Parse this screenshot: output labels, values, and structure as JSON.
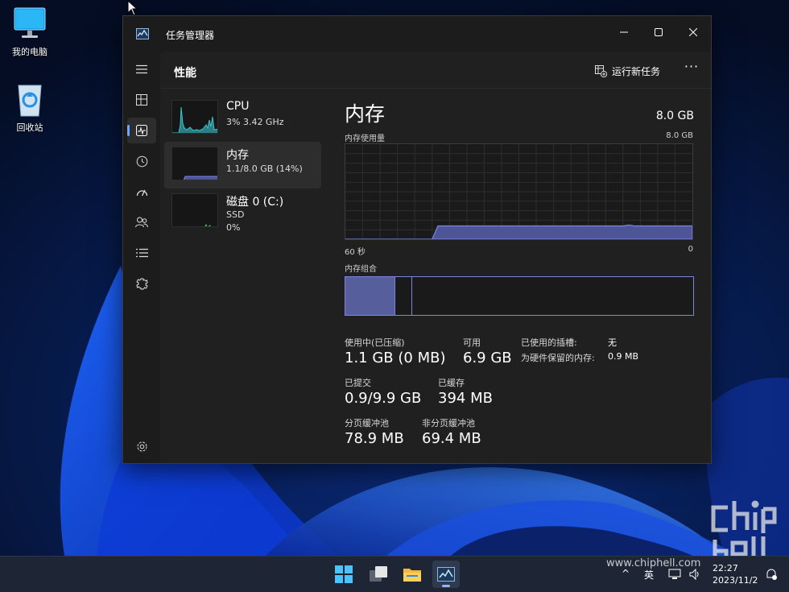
{
  "desktop": {
    "icons": [
      {
        "label": "我的电脑",
        "icon": "monitor-icon"
      },
      {
        "label": "回收站",
        "icon": "recycle-bin-icon"
      }
    ]
  },
  "window": {
    "title": "任务管理器",
    "app_icon": "task-manager-icon"
  },
  "nav": {
    "items": [
      {
        "icon": "hamburger-menu-icon"
      },
      {
        "icon": "processes-icon"
      },
      {
        "icon": "performance-icon",
        "active": true
      },
      {
        "icon": "app-history-icon"
      },
      {
        "icon": "startup-apps-icon"
      },
      {
        "icon": "users-icon"
      },
      {
        "icon": "details-icon"
      },
      {
        "icon": "services-icon"
      },
      {
        "icon": "settings-icon"
      }
    ]
  },
  "header": {
    "title": "性能",
    "run_task_label": "运行新任务",
    "more_label": "···"
  },
  "devices": [
    {
      "name": "CPU",
      "sub1": "3% 3.42 GHz",
      "sub2": ""
    },
    {
      "name": "内存",
      "sub1": "1.1/8.0 GB (14%)",
      "sub2": "",
      "selected": true
    },
    {
      "name": "磁盘 0 (C:)",
      "sub1": "SSD",
      "sub2": "0%"
    }
  ],
  "memory": {
    "title": "内存",
    "total": "8.0 GB",
    "usage_label": "内存使用量",
    "usage_max": "8.0 GB",
    "time_left": "60 秒",
    "time_right": "0",
    "composition_label": "内存组合",
    "usage_history_percent": [
      0,
      0,
      0,
      0,
      0,
      0,
      0,
      0,
      0,
      0,
      0,
      0,
      0,
      0,
      0,
      0,
      14,
      14,
      14,
      14,
      14,
      14,
      14,
      14,
      14,
      14,
      14,
      14,
      14,
      14,
      14,
      14,
      14,
      14,
      14,
      14,
      14,
      14,
      14,
      14,
      14,
      14,
      14,
      14,
      14,
      14,
      14,
      14,
      14,
      15,
      14,
      14,
      14,
      14,
      14,
      14,
      14,
      14,
      14,
      14,
      14
    ],
    "composition": {
      "in_use_fraction": 0.14,
      "modified_fraction": 0.05
    },
    "stats": {
      "in_use": {
        "label": "使用中(已压缩)",
        "value": "1.1 GB (0 MB)"
      },
      "available": {
        "label": "可用",
        "value": "6.9 GB"
      },
      "slots_used": {
        "label": "已使用的插槽:",
        "value": "无"
      },
      "hw_reserved": {
        "label": "为硬件保留的内存:",
        "value": "0.9 MB"
      },
      "committed": {
        "label": "已提交",
        "value": "0.9/9.9 GB"
      },
      "cached": {
        "label": "已缓存",
        "value": "394 MB"
      },
      "paged_pool": {
        "label": "分页缓冲池",
        "value": "78.9 MB"
      },
      "nonpaged_pool": {
        "label": "非分页缓冲池",
        "value": "69.4 MB"
      }
    }
  },
  "taskbar": {
    "apps": [
      {
        "icon": "windows-start-icon"
      },
      {
        "icon": "task-view-icon"
      },
      {
        "icon": "file-explorer-icon"
      },
      {
        "icon": "task-manager-icon",
        "active": true
      }
    ],
    "tray": {
      "chevron": "^",
      "ime": "英",
      "time": "22:27",
      "date": "2023/11/2"
    },
    "watermark": "www.chiphell.com"
  },
  "colors": {
    "accent": "#6ca6ff",
    "memory_graph": "#7b86e0",
    "memory_fill": "#4d5597",
    "cpu_graph": "#3ec1c8"
  }
}
